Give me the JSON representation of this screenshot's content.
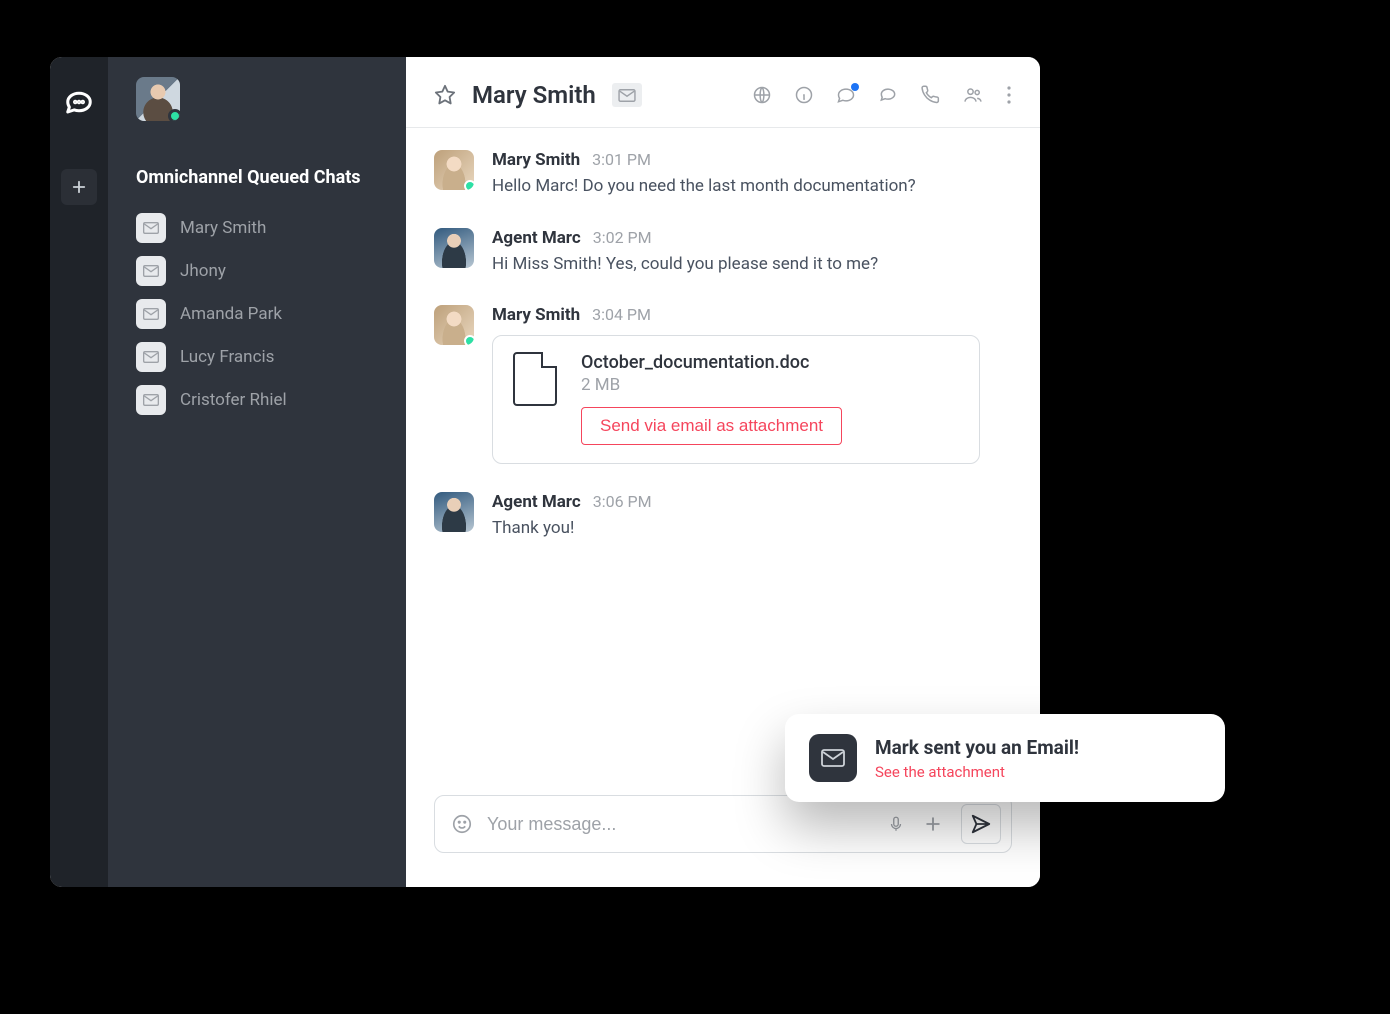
{
  "sidebar": {
    "section_title": "Omnichannel Queued Chats",
    "chats": [
      {
        "name": "Mary Smith"
      },
      {
        "name": "Jhony"
      },
      {
        "name": "Amanda Park"
      },
      {
        "name": "Lucy Francis"
      },
      {
        "name": "Cristofer Rhiel"
      }
    ]
  },
  "conversation": {
    "title": "Mary Smith",
    "channel_icon": "email-icon",
    "messages": [
      {
        "avatar": "mary",
        "presence": true,
        "sender": "Mary Smith",
        "time": "3:01 PM",
        "text": "Hello Marc! Do you need the last month documentation?"
      },
      {
        "avatar": "marc",
        "presence": false,
        "sender": "Agent Marc",
        "time": "3:02 PM",
        "text": "Hi Miss Smith! Yes, could you please send it to me?"
      },
      {
        "avatar": "mary",
        "presence": true,
        "sender": "Mary Smith",
        "time": "3:04 PM",
        "attachment": {
          "filename": "October_documentation.doc",
          "size": "2 MB",
          "action_label": "Send via email as attachment"
        }
      },
      {
        "avatar": "marc",
        "presence": false,
        "sender": "Agent Marc",
        "time": "3:06 PM",
        "text": "Thank you!"
      }
    ]
  },
  "composer": {
    "placeholder": "Your message..."
  },
  "toast": {
    "title": "Mark sent you an Email!",
    "link": "See the attachment"
  },
  "icons": {
    "globe": "globe-icon",
    "info": "info-icon",
    "discussion": "discussion-icon",
    "thread": "thread-icon",
    "call": "call-icon",
    "members": "members-icon",
    "kebab": "kebab-icon"
  }
}
